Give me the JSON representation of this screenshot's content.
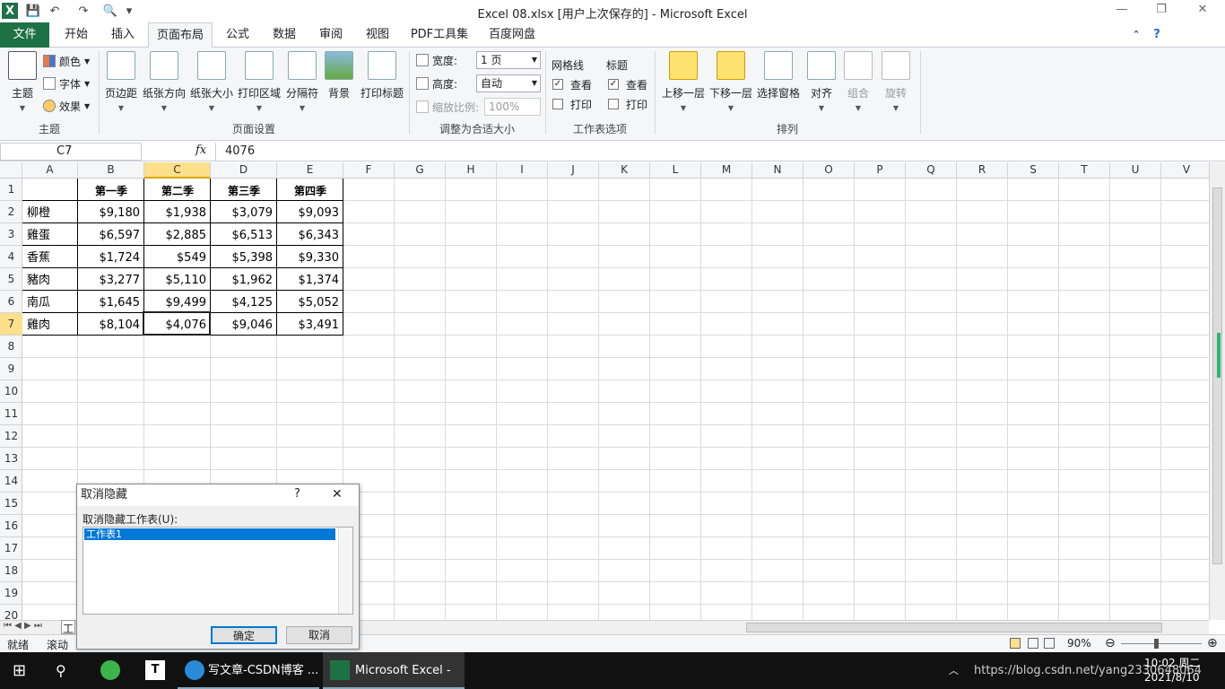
{
  "window": {
    "title": "Excel 08.xlsx [用户上次保存的] - Microsoft Excel",
    "minimize": "—",
    "restore": "❐",
    "close": "✕"
  },
  "qat": {
    "save": "💾",
    "undo": "↶",
    "redo": "↷",
    "preview": "🔍",
    "customize": "▾"
  },
  "tabs": [
    "文件",
    "开始",
    "插入",
    "页面布局",
    "公式",
    "数据",
    "审阅",
    "视图",
    "PDF工具集",
    "百度网盘"
  ],
  "ribbon": {
    "themes": {
      "theme": "主题",
      "colors": "颜色",
      "fonts": "字体",
      "effects": "效果",
      "group": "主题"
    },
    "page_setup": {
      "margins": "页边距",
      "orientation": "纸张方向",
      "size": "纸张大小",
      "print_area": "打印区域",
      "breaks": "分隔符",
      "background": "背景",
      "print_titles": "打印标题",
      "group": "页面设置"
    },
    "scale": {
      "width_label": "宽度:",
      "width_value": "1 页",
      "height_label": "高度:",
      "height_value": "自动",
      "scale_label": "缩放比例:",
      "scale_value": "100%",
      "group": "调整为合适大小"
    },
    "sheet_options": {
      "gridlines": "网格线",
      "headings": "标题",
      "view": "查看",
      "print": "打印",
      "group": "工作表选项",
      "gridlines_view": true,
      "gridlines_print": false,
      "headings_view": true,
      "headings_print": false
    },
    "arrange": {
      "bring_forward": "上移一层",
      "send_backward": "下移一层",
      "selection_pane": "选择窗格",
      "align": "对齐",
      "group_btn": "组合",
      "rotate": "旋转",
      "group": "排列"
    }
  },
  "formula_bar": {
    "name_box": "C7",
    "fx": "fx",
    "content": "4076"
  },
  "columns": [
    "A",
    "B",
    "C",
    "D",
    "E",
    "F",
    "G",
    "H",
    "I",
    "J",
    "K",
    "L",
    "M",
    "N",
    "O",
    "P",
    "Q",
    "R",
    "S",
    "T",
    "U",
    "V"
  ],
  "rows": [
    "1",
    "2",
    "3",
    "4",
    "5",
    "6",
    "7",
    "8",
    "9",
    "10",
    "11",
    "12",
    "13",
    "14",
    "15",
    "16",
    "17",
    "18",
    "19",
    "20"
  ],
  "sheet": {
    "headers": [
      "",
      "第一季",
      "第二季",
      "第三季",
      "第四季"
    ],
    "data": [
      [
        "柳橙",
        "$9,180",
        "$1,938",
        "$3,079",
        "$9,093"
      ],
      [
        "雞蛋",
        "$6,597",
        "$2,885",
        "$6,513",
        "$6,343"
      ],
      [
        "香蕉",
        "$1,724",
        "$549",
        "$5,398",
        "$9,330"
      ],
      [
        "豬肉",
        "$3,277",
        "$5,110",
        "$1,962",
        "$1,374"
      ],
      [
        "南瓜",
        "$1,645",
        "$9,499",
        "$4,125",
        "$5,052"
      ],
      [
        "雞肉",
        "$8,104",
        "$4,076",
        "$9,046",
        "$3,491"
      ]
    ]
  },
  "status": {
    "ready": "就绪",
    "scroll": "滚动",
    "zoom": "90%",
    "sheet_tab": "工"
  },
  "dialog": {
    "title": "取消隐藏",
    "help": "?",
    "close": "✕",
    "label": "取消隐藏工作表(U):",
    "items": [
      "工作表1"
    ],
    "ok": "确定",
    "cancel": "取消"
  },
  "taskbar": {
    "csdn": "写文章-CSDN博客 ...",
    "excel": "Microsoft Excel - ...",
    "time": "10:02 周二",
    "date": "2021/8/10",
    "watermark": "https://blog.csdn.net/yang2330648064"
  }
}
